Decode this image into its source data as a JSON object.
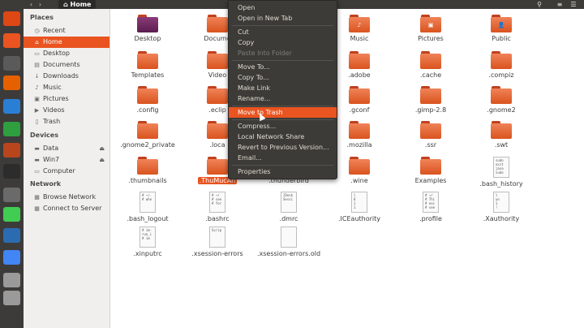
{
  "topbar": {
    "back_icon": "chevron-left-icon",
    "forward_icon": "chevron-right-icon",
    "path_label": "Home",
    "search_icon": "search-icon",
    "menu_icon": "hamburger-icon"
  },
  "launcher": {
    "items": [
      "ubuntu-logo-icon",
      "software-center-icon",
      "files-icon",
      "firefox-icon",
      "writer-icon",
      "calc-icon",
      "impress-icon",
      "terminal-icon",
      "settings-icon",
      "qt-icon",
      "virtualbox-icon",
      "chrome-icon",
      "drive-icon",
      "drive-icon"
    ]
  },
  "sidebar": {
    "places_heading": "Places",
    "places": [
      {
        "label": "Recent",
        "icon": "clock-icon"
      },
      {
        "label": "Home",
        "icon": "home-icon",
        "active": true
      },
      {
        "label": "Desktop",
        "icon": "desktop-icon"
      },
      {
        "label": "Documents",
        "icon": "documents-icon"
      },
      {
        "label": "Downloads",
        "icon": "downloads-icon"
      },
      {
        "label": "Music",
        "icon": "music-icon"
      },
      {
        "label": "Pictures",
        "icon": "pictures-icon"
      },
      {
        "label": "Videos",
        "icon": "videos-icon"
      },
      {
        "label": "Trash",
        "icon": "trash-icon"
      }
    ],
    "devices_heading": "Devices",
    "devices": [
      {
        "label": "Data",
        "icon": "drive-icon",
        "eject": true
      },
      {
        "label": "Win7",
        "icon": "drive-icon",
        "eject": true
      },
      {
        "label": "Computer",
        "icon": "computer-icon"
      }
    ],
    "network_heading": "Network",
    "network": [
      {
        "label": "Browse Network",
        "icon": "network-icon"
      },
      {
        "label": "Connect to Server",
        "icon": "server-icon"
      }
    ]
  },
  "files": [
    {
      "name": "Desktop",
      "kind": "folder",
      "variant": "desk"
    },
    {
      "name": "Docume",
      "kind": "folder"
    },
    {
      "name": "Music",
      "kind": "folder",
      "emblem": "♪"
    },
    {
      "name": "Pictures",
      "kind": "folder",
      "emblem": "▣"
    },
    {
      "name": "Public",
      "kind": "folder",
      "emblem": "👤"
    },
    {
      "name": "Templates",
      "kind": "folder"
    },
    {
      "name": "Video",
      "kind": "folder"
    },
    {
      "name": ".adobe",
      "kind": "folder"
    },
    {
      "name": ".cache",
      "kind": "folder"
    },
    {
      "name": ".compiz",
      "kind": "folder"
    },
    {
      "name": ".config",
      "kind": "folder"
    },
    {
      "name": ".eclip",
      "kind": "folder"
    },
    {
      "name": ".gconf",
      "kind": "folder"
    },
    {
      "name": ".gimp-2.8",
      "kind": "folder"
    },
    {
      "name": ".gnome2",
      "kind": "folder"
    },
    {
      "name": ".gnome2_private",
      "kind": "folder"
    },
    {
      "name": ".loca",
      "kind": "folder"
    },
    {
      "name": ".mozilla",
      "kind": "folder"
    },
    {
      "name": ".ssr",
      "kind": "folder"
    },
    {
      "name": ".swt",
      "kind": "folder"
    },
    {
      "name": ".thumbnails",
      "kind": "folder"
    },
    {
      "name": ".ThuMucAn",
      "kind": "folder",
      "selected": true
    },
    {
      "name": ".thunderbird",
      "kind": "folder"
    },
    {
      "name": ".wine",
      "kind": "folder"
    },
    {
      "name": "Examples",
      "kind": "folder"
    },
    {
      "name": ".bash_history",
      "kind": "doc",
      "preview": "sudo\nexit\njava\nsudo"
    },
    {
      "name": ".bash_logout",
      "kind": "doc",
      "preview": "# ~/.\n# whe"
    },
    {
      "name": ".bashrc",
      "kind": "doc",
      "preview": "# ~/\n# see\n# for"
    },
    {
      "name": ".dmrc",
      "kind": "doc",
      "preview": "[Desk\nSessi"
    },
    {
      "name": ".ICEauthority",
      "kind": "doc",
      "preview": "l\n8\n1\n1"
    },
    {
      "name": ".profile",
      "kind": "doc",
      "preview": "# ~/\n# Thi\n# exi\n# see"
    },
    {
      "name": ".Xauthority",
      "kind": "doc",
      "preview": "l\nun\n1\n!"
    },
    {
      "name": ".xinputrc",
      "kind": "doc",
      "preview": "# im-\nrun_i\n# im"
    },
    {
      "name": ".xsession-errors",
      "kind": "doc",
      "preview": "Scrip"
    },
    {
      "name": ".xsession-errors.old",
      "kind": "doc",
      "preview": ""
    }
  ],
  "context_menu": {
    "items": [
      {
        "label": "Open"
      },
      {
        "label": "Open in New Tab"
      },
      {
        "sep": true
      },
      {
        "label": "Cut"
      },
      {
        "label": "Copy"
      },
      {
        "label": "Paste Into Folder",
        "disabled": true
      },
      {
        "sep": true
      },
      {
        "label": "Move To..."
      },
      {
        "label": "Copy To..."
      },
      {
        "label": "Make Link"
      },
      {
        "label": "Rename..."
      },
      {
        "sep": true
      },
      {
        "label": "Move to Trash",
        "highlight": true
      },
      {
        "sep": true
      },
      {
        "label": "Compress..."
      },
      {
        "label": "Local Network Share"
      },
      {
        "label": "Revert to Previous Version..."
      },
      {
        "label": "Email..."
      },
      {
        "sep": true
      },
      {
        "label": "Properties"
      }
    ]
  },
  "colors": {
    "accent": "#e95420",
    "menu_bg": "#3c3b37",
    "sidebar_bg": "#f0efee"
  }
}
